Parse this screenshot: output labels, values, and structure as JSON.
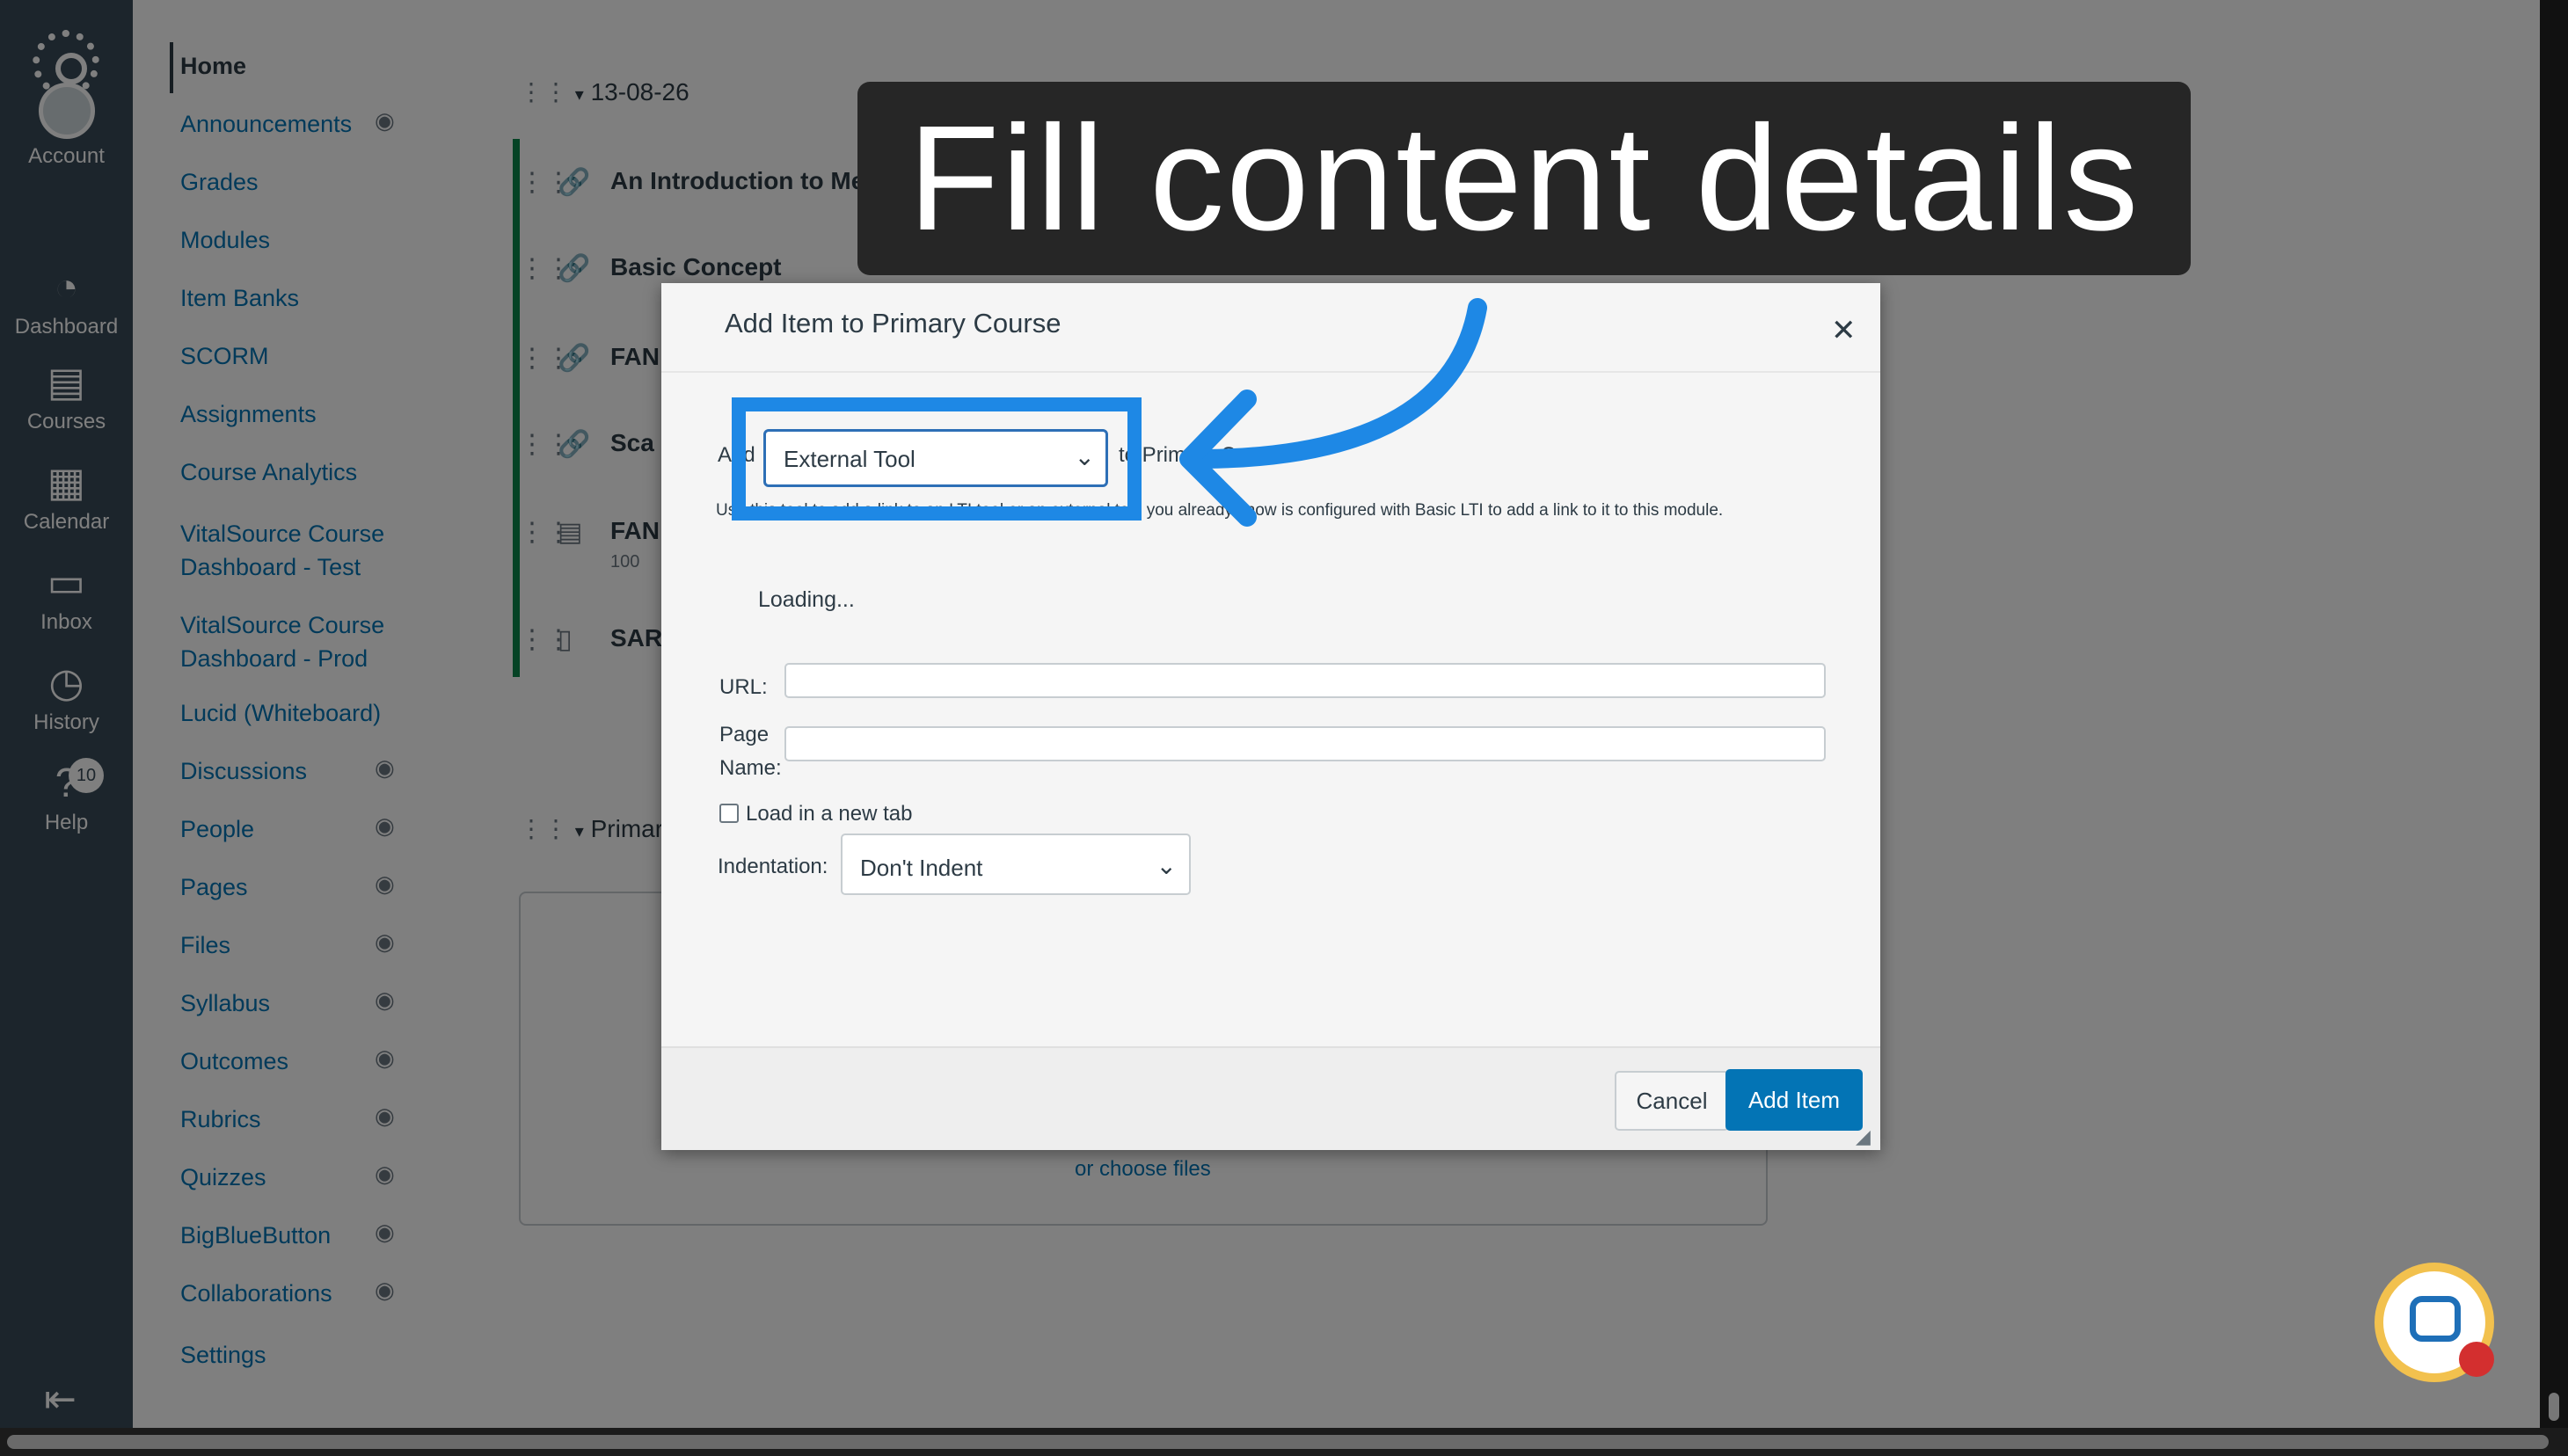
{
  "global_nav": {
    "items": [
      {
        "label": "Account",
        "icon": "user-icon"
      },
      {
        "label": "Dashboard",
        "icon": "dashboard-icon"
      },
      {
        "label": "Courses",
        "icon": "courses-icon"
      },
      {
        "label": "Calendar",
        "icon": "calendar-icon"
      },
      {
        "label": "Inbox",
        "icon": "inbox-icon"
      },
      {
        "label": "History",
        "icon": "history-icon"
      },
      {
        "label": "Help",
        "icon": "help-icon"
      }
    ],
    "help_badge": "10",
    "active": "Courses"
  },
  "course_nav": {
    "items": [
      {
        "label": "Home"
      },
      {
        "label": "Announcements"
      },
      {
        "label": "Grades"
      },
      {
        "label": "Modules"
      },
      {
        "label": "Item Banks"
      },
      {
        "label": "SCORM"
      },
      {
        "label": "Assignments"
      },
      {
        "label": "Course Analytics"
      },
      {
        "label": "VitalSource Course Dashboard - Test"
      },
      {
        "label": "VitalSource Course Dashboard - Prod"
      },
      {
        "label": "Lucid (Whiteboard)"
      },
      {
        "label": "Discussions"
      },
      {
        "label": "People"
      },
      {
        "label": "Pages"
      },
      {
        "label": "Files"
      },
      {
        "label": "Syllabus"
      },
      {
        "label": "Outcomes"
      },
      {
        "label": "Rubrics"
      },
      {
        "label": "Quizzes"
      },
      {
        "label": "BigBlueButton"
      },
      {
        "label": "Collaborations"
      },
      {
        "label": "Settings"
      }
    ]
  },
  "modules": {
    "first_module_title": "13-08-26",
    "items": [
      {
        "title": "An Introduction to Me"
      },
      {
        "title": "Basic Concept"
      },
      {
        "title": "FAN"
      },
      {
        "title": "Sca"
      },
      {
        "title": "FAN",
        "sub": "100"
      },
      {
        "title": "SAR"
      }
    ],
    "second_module_title": "Primary",
    "drop_zone_text": "or choose files"
  },
  "modal": {
    "title": "Add Item to Primary Course",
    "add_prefix": "Add",
    "to_suffix": "to Primary Course",
    "selected_type": "External Tool",
    "help_text": "Use this tool to add a link to an LTI tool or an external tool you already know is configured with Basic LTI to add a link to it to this module.",
    "loading": "Loading...",
    "url_label": "URL:",
    "page_name_label_1": "Page",
    "page_name_label_2": "Name:",
    "load_new_tab_label": "Load in a new tab",
    "indentation_label": "Indentation:",
    "indentation_value": "Don't Indent",
    "cancel_label": "Cancel",
    "add_item_label": "Add Item"
  },
  "callout": {
    "text": "Fill content details"
  },
  "colors": {
    "accent": "#1E88E5",
    "canvas_nav": "#394B58",
    "primary_button": "#0374B5"
  }
}
